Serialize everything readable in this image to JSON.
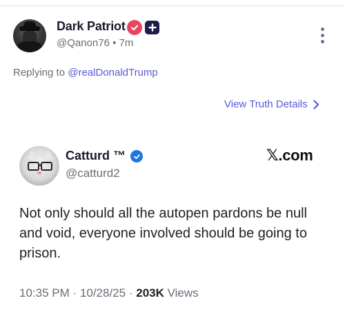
{
  "author": {
    "display_name": "Dark Patriot",
    "handle": "@Qanon76",
    "separator": "•",
    "age": "7m",
    "badges": [
      "verified-badge-icon",
      "plus-badge-icon"
    ]
  },
  "reply": {
    "prefix": "Replying to",
    "mention": "@realDonaldTrump"
  },
  "view_details": {
    "label": "View Truth Details",
    "icon": "chevron-right-icon"
  },
  "quoted": {
    "display_name": "Catturd ™",
    "handle": "@catturd2",
    "source": "𝕏.com",
    "text": "Not only should all the autopen pardons be null and void, everyone involved should be going to prison.",
    "time": "10:35 PM",
    "date": "10/28/25",
    "dot": "·",
    "views_count": "203K",
    "views_label": "Views"
  },
  "colors": {
    "accent": "#5a57d6",
    "badge_red": "#e8455f",
    "badge_navy": "#1f1d4d",
    "verified_blue": "#1d77e0",
    "muted": "#6b6b78"
  }
}
